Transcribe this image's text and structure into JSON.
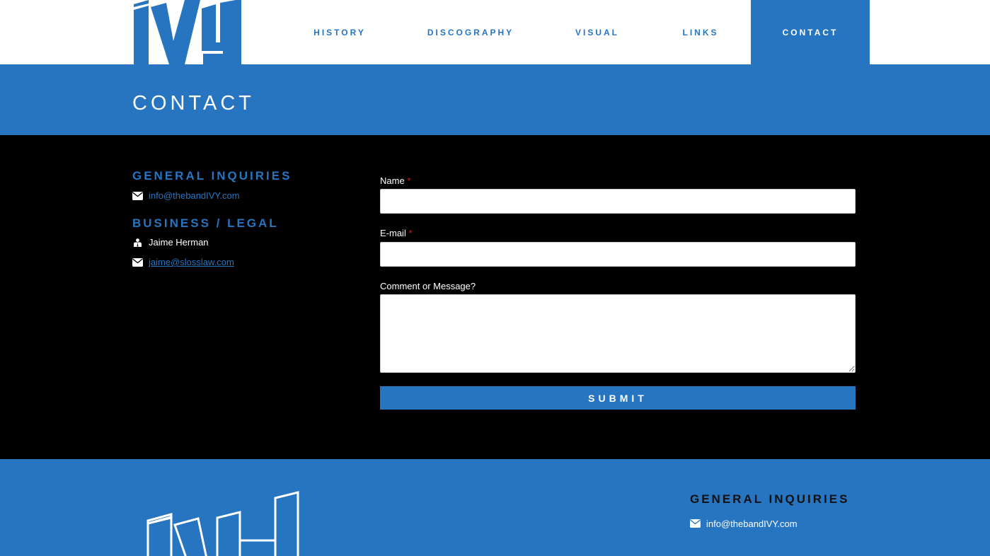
{
  "brand": {
    "logo_text": "IVY",
    "accent": "#2775c1"
  },
  "nav": {
    "items": [
      {
        "label": "HISTORY"
      },
      {
        "label": "DISCOGRAPHY"
      },
      {
        "label": "VISUAL"
      },
      {
        "label": "LINKS"
      },
      {
        "label": "CONTACT",
        "active": true
      }
    ]
  },
  "page": {
    "title": "CONTACT"
  },
  "contact_info": {
    "general": {
      "heading": "GENERAL INQUIRIES",
      "email": "info@thebandIVY.com",
      "icon": "envelope-icon"
    },
    "business": {
      "heading": "BUSINESS / LEGAL",
      "person": "Jaime Herman",
      "person_icon": "user-icon",
      "email": "jaime@slosslaw.com",
      "email_icon": "envelope-icon"
    }
  },
  "form": {
    "name": {
      "label": "Name",
      "required_mark": "*",
      "value": ""
    },
    "email": {
      "label": "E-mail",
      "required_mark": "*",
      "value": ""
    },
    "message": {
      "label": "Comment or Message?",
      "value": ""
    },
    "submit_label": "SUBMIT"
  },
  "footer": {
    "heading": "GENERAL INQUIRIES",
    "email": "info@thebandIVY.com",
    "icon": "envelope-icon"
  }
}
